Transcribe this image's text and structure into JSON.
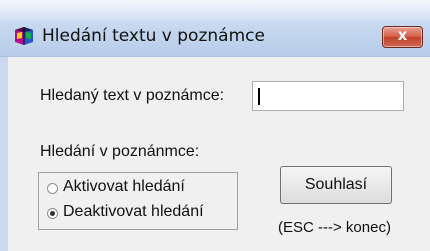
{
  "window": {
    "title": "Hledání textu v poznámce",
    "close_label": "x"
  },
  "search": {
    "label": "Hledaný text v poznámce:",
    "value": ""
  },
  "options": {
    "group_label": "Hledání v poznánmce:",
    "radios": [
      {
        "label": "Aktivovat hledání",
        "checked": false
      },
      {
        "label": "Deaktivovat hledání",
        "checked": true
      }
    ]
  },
  "confirm": {
    "label": "Souhlasí",
    "hint": "(ESC ---> konec)"
  }
}
